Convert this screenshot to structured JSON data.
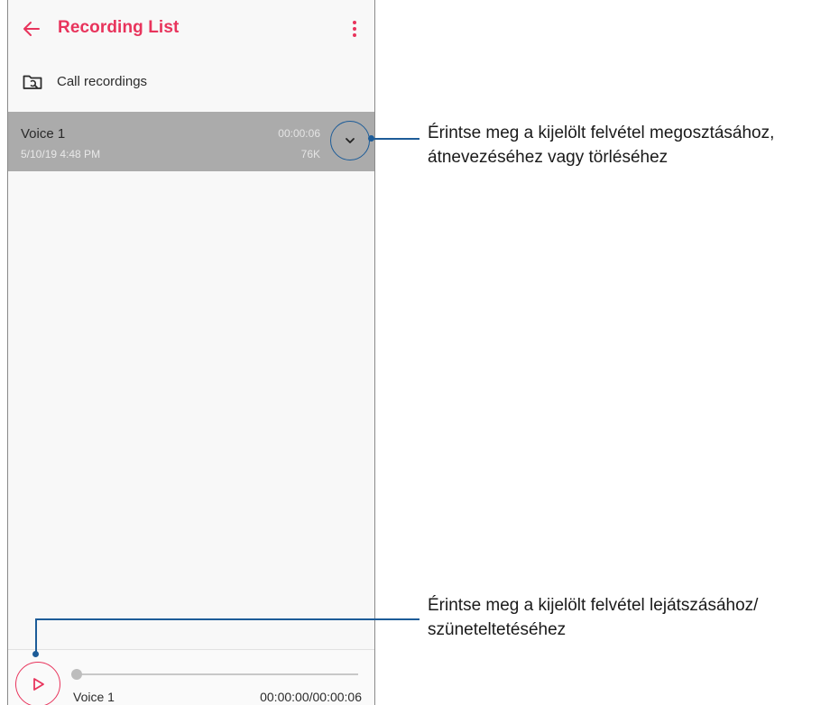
{
  "app_bar": {
    "title": "Recording List",
    "back_icon": "arrow-left-icon",
    "more_icon": "more-vert-icon",
    "accent_color": "#e8345c"
  },
  "call_recordings": {
    "icon": "folder-icon",
    "label": "Call recordings"
  },
  "recordings": [
    {
      "name": "Voice 1",
      "date": "5/10/19 4:48 PM",
      "duration": "00:00:06",
      "size": "76K",
      "selected": true,
      "expand_icon": "chevron-down-icon"
    }
  ],
  "player": {
    "play_icon": "play-icon",
    "name": "Voice 1",
    "time": "00:00:00/00:00:06",
    "progress": 0
  },
  "callouts": {
    "expand": {
      "line1": "Érintse meg a kijelölt felvétel megosztásához,",
      "line2": "átnevezéséhez vagy törléséhez"
    },
    "play": {
      "line1": "Érintse meg a kijelölt felvétel lejátszásához/",
      "line2": "szüneteltetéséhez"
    },
    "line_color": "#1d5c98"
  }
}
